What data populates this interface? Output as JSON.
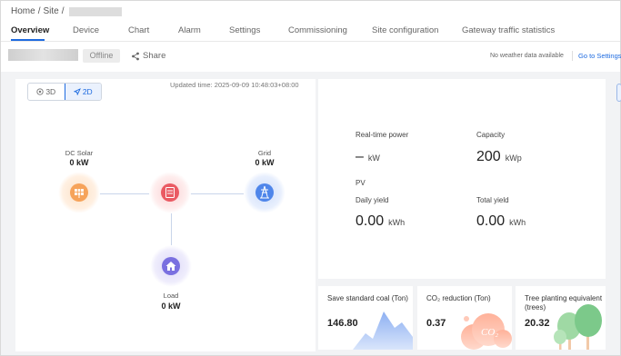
{
  "breadcrumb": {
    "home": "Home",
    "sep1": "/",
    "site": "Site",
    "sep2": "/"
  },
  "tabs": [
    {
      "label": "Overview",
      "active": true
    },
    {
      "label": "Device"
    },
    {
      "label": "Chart"
    },
    {
      "label": "Alarm"
    },
    {
      "label": "Settings"
    },
    {
      "label": "Commissioning"
    },
    {
      "label": "Site configuration"
    },
    {
      "label": "Gateway traffic statistics"
    }
  ],
  "status": {
    "badge": "Offline",
    "share": "Share"
  },
  "weather": {
    "text": "No weather data available",
    "link": "Go to Settings"
  },
  "flow": {
    "view_3d": "3D",
    "view_2d": "2D",
    "updated": "Updated time: 2025-09-09 10:48:03+08:00",
    "solar": {
      "label": "DC Solar",
      "value": "0 kW"
    },
    "grid": {
      "label": "Grid",
      "value": "0 kW"
    },
    "load": {
      "label": "Load",
      "value": "0 kW"
    }
  },
  "stats": {
    "realtime_label": "Real-time power",
    "realtime_value": "–",
    "realtime_unit": "kW",
    "capacity_label": "Capacity",
    "capacity_value": "200",
    "capacity_unit": "kWp",
    "pv_label": "PV",
    "daily_label": "Daily yield",
    "daily_value": "0.00",
    "daily_unit": "kWh",
    "total_label": "Total yield",
    "total_value": "0.00",
    "total_unit": "kWh"
  },
  "env": {
    "coal_title": "Save standard coal (Ton)",
    "coal_value": "146.80",
    "co2_title": "CO₂ reduction (Ton)",
    "co2_value": "0.37",
    "co2_art": "CO₂",
    "tree_title": "Tree planting equivalent (trees)",
    "tree_value": "20.32"
  },
  "colors": {
    "accent": "#1e6be0",
    "solar": "#f39c4d",
    "inverter": "#e0454f",
    "grid": "#3e7be8",
    "load": "#6b63d9"
  }
}
